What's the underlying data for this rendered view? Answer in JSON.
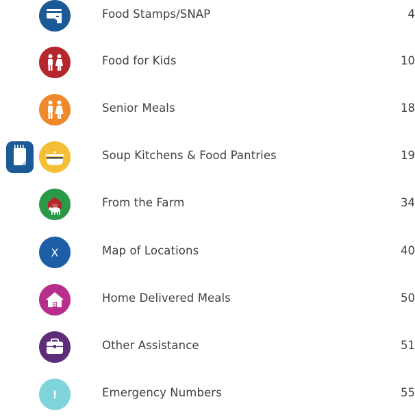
{
  "toc": {
    "items": [
      {
        "label": "Food Stamps/SNAP",
        "page": "4",
        "icon": "snap-card-icon",
        "color": "#1b5a96"
      },
      {
        "label": "Food for Kids",
        "page": "10",
        "icon": "kids-icon",
        "color": "#b5272d"
      },
      {
        "label": "Senior Meals",
        "page": "18",
        "icon": "seniors-icon",
        "color": "#ee8a2b"
      },
      {
        "label": "Soup Kitchens & Food Pantries",
        "page": "19",
        "icon": "soup-pot-icon",
        "color": "#f4bf34"
      },
      {
        "label": "From the Farm",
        "page": "34",
        "icon": "farm-cow-icon",
        "color": "#2b9a48"
      },
      {
        "label": "Map of Locations",
        "page": "40",
        "icon": "map-x-icon",
        "color": "#1c5fa6",
        "icon_text": "X"
      },
      {
        "label": "Home Delivered Meals",
        "page": "50",
        "icon": "house-icon",
        "color": "#b72e8d"
      },
      {
        "label": "Other Assistance",
        "page": "51",
        "icon": "briefcase-icon",
        "color": "#5d2d7a"
      },
      {
        "label": "Emergency Numbers",
        "page": "55",
        "icon": "exclamation-icon",
        "color": "#7fd3da",
        "icon_text": "!"
      }
    ],
    "side_icon": {
      "icon": "notepad-icon",
      "color": "#1b5a96"
    }
  }
}
